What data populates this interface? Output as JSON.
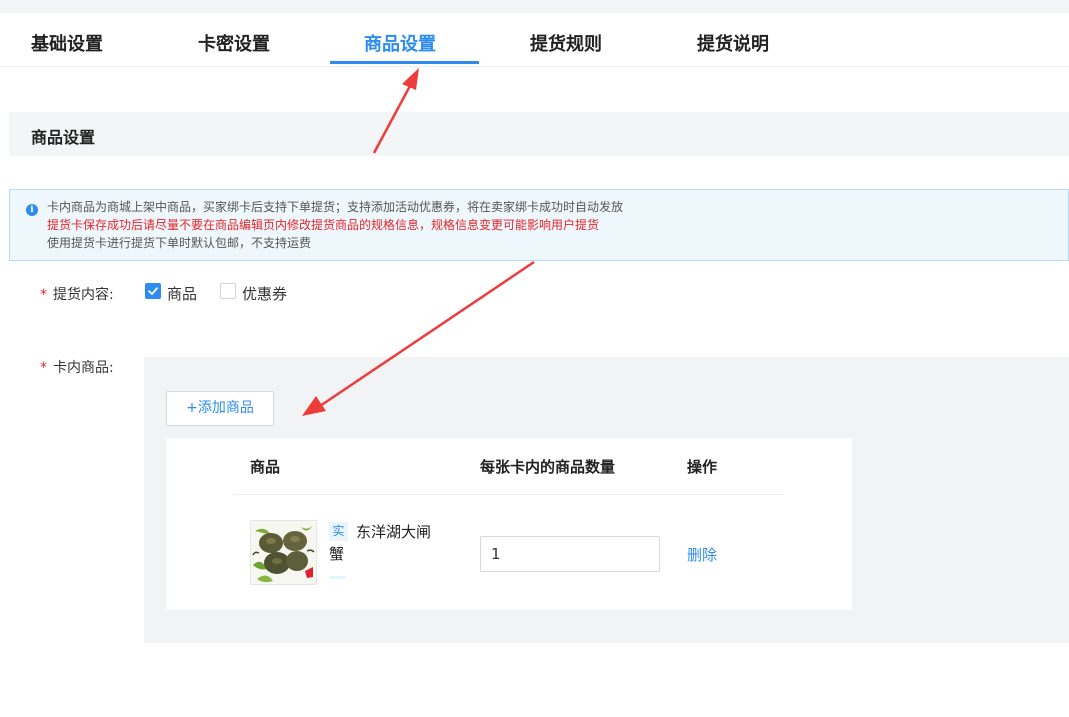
{
  "tabs": [
    {
      "label": "基础设置",
      "active": false
    },
    {
      "label": "卡密设置",
      "active": false
    },
    {
      "label": "商品设置",
      "active": true
    },
    {
      "label": "提货规则",
      "active": false
    },
    {
      "label": "提货说明",
      "active": false
    }
  ],
  "section": {
    "title": "商品设置"
  },
  "notice": {
    "icon": "info-icon",
    "lines": [
      "卡内商品为商城上架中商品，买家绑卡后支持下单提货；支持添加活动优惠券，将在卖家绑卡成功时自动发放",
      "提货卡保存成功后请尽量不要在商品编辑页内修改提货商品的规格信息，规格信息变更可能影响用户提货",
      "使用提货卡进行提货下单时默认包邮，不支持运费"
    ]
  },
  "form": {
    "content": {
      "required_mark": "*",
      "label": "提货内容:",
      "options": [
        {
          "label": "商品",
          "checked": true
        },
        {
          "label": "优惠券",
          "checked": false
        }
      ]
    },
    "goods": {
      "required_mark": "*",
      "label": "卡内商品:",
      "add_button": "+添加商品",
      "table": {
        "headers": [
          "商品",
          "每张卡内的商品数量",
          "操作"
        ],
        "rows": [
          {
            "tag": "实",
            "name_line1": "东洋湖大闸",
            "name_line2": "蟹",
            "quantity": "1",
            "action": "删除"
          }
        ]
      }
    }
  },
  "colors": {
    "accent": "#2d8cf0",
    "required": "#e5262d",
    "annotation_arrow": "#ee3b3b"
  }
}
